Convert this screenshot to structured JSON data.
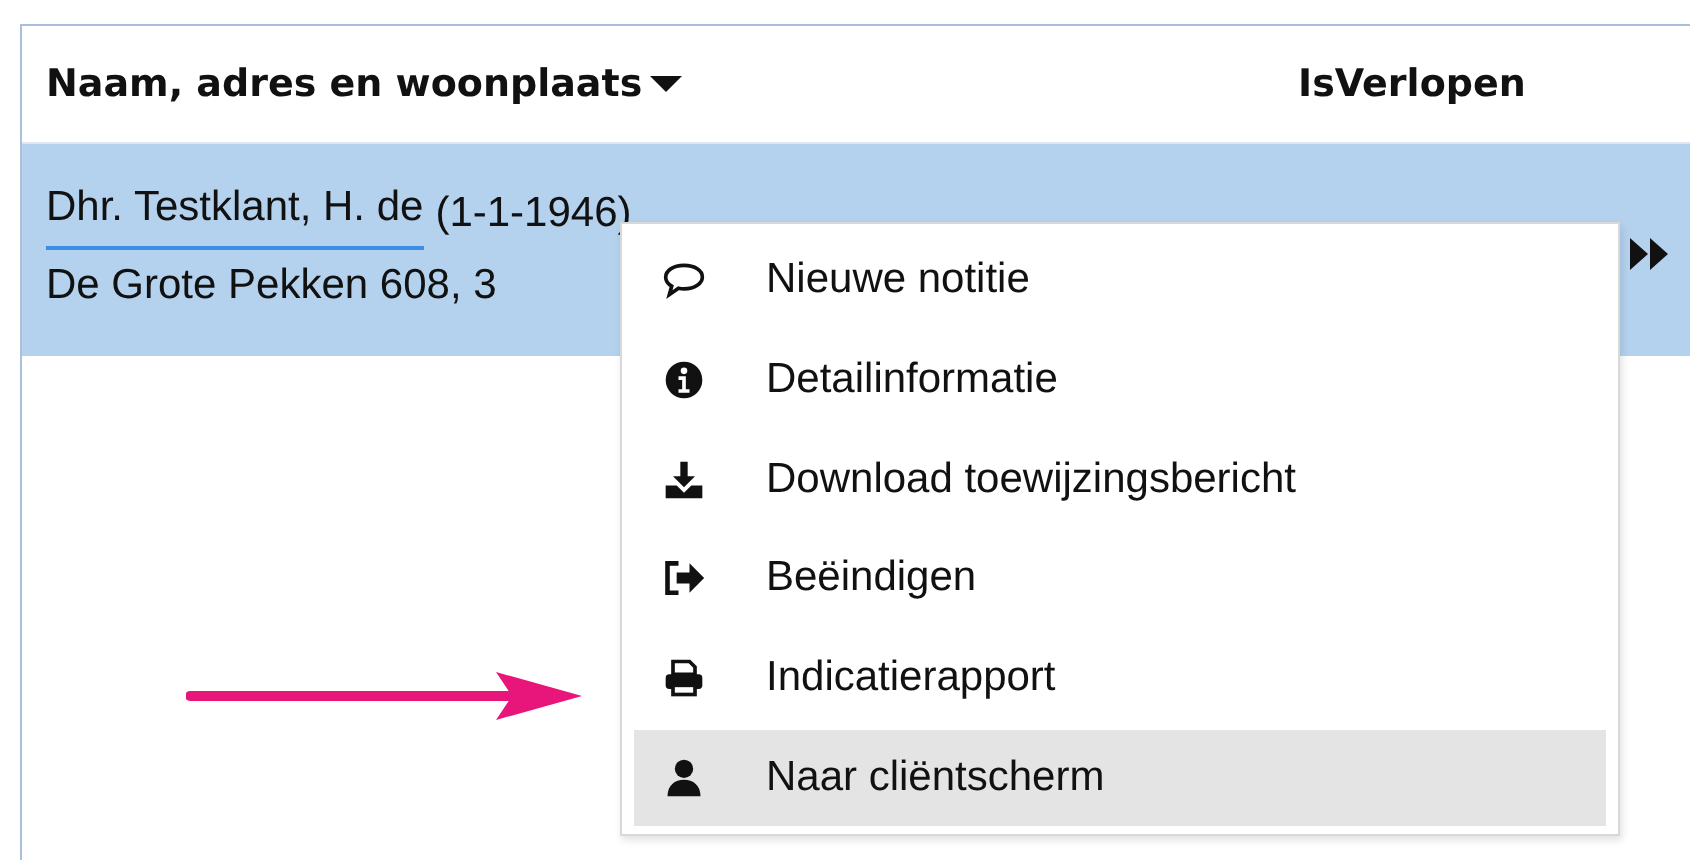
{
  "table": {
    "columns": [
      {
        "label": "Naam, adres en woonplaats",
        "sorted": true
      },
      {
        "label": "IsVerlopen",
        "sorted": false
      }
    ],
    "rows": [
      {
        "name": "Dhr. Testklant, H. de",
        "birth_date": "(1-1-1946)",
        "address": "De Grote Pekken 608, 3",
        "selected": true
      }
    ]
  },
  "context_menu": {
    "items": [
      {
        "label": "Nieuwe notitie",
        "selected": false
      },
      {
        "label": "Detailinformatie",
        "selected": false
      },
      {
        "label": "Download toewijzingsbericht",
        "selected": false
      },
      {
        "label": "Beëindigen",
        "selected": false
      },
      {
        "label": "Indicatierapport",
        "selected": false
      },
      {
        "label": "Naar cliëntscherm",
        "selected": true
      }
    ]
  }
}
